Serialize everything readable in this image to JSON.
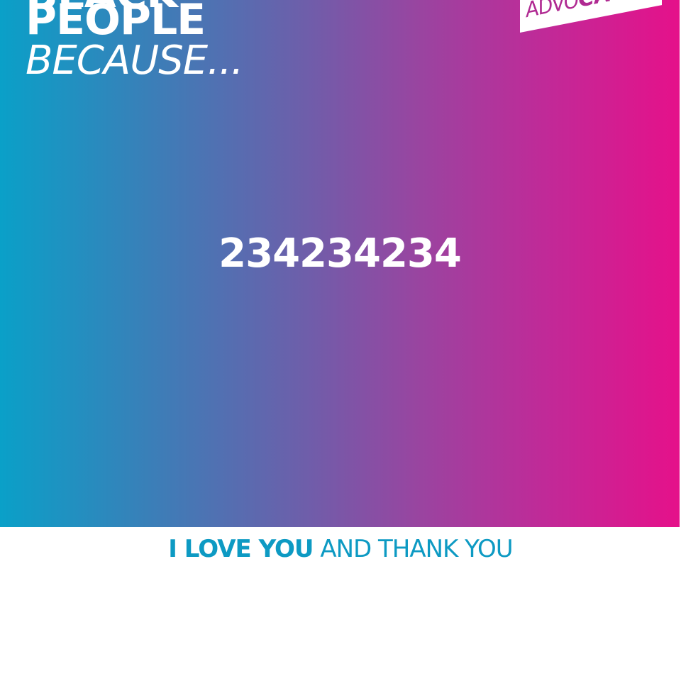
{
  "headline": {
    "cut_line": "BLACK",
    "line1": "PEOPLE",
    "line2": "BECAUSE..."
  },
  "logo": {
    "light_text": "ADVO",
    "bold_text": "CACY"
  },
  "center_value": "234234234",
  "footer": {
    "strong": "I LOVE YOU",
    "rest": " AND THANK YOU"
  },
  "colors": {
    "gradient_start": "#0aa0c8",
    "gradient_end": "#e5118a",
    "footer_text": "#0d9ac3",
    "logo_text": "#b02a92"
  }
}
